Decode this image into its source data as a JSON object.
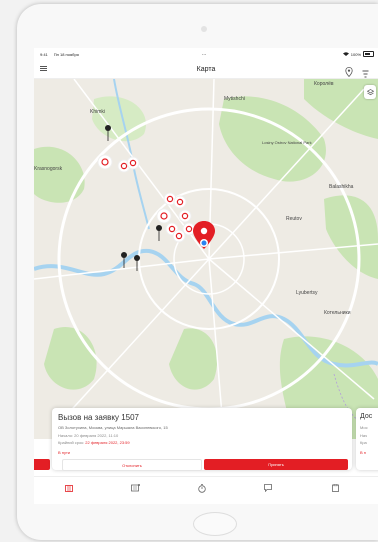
{
  "status_bar": {
    "time": "9:41",
    "date": "Пн 18 ноября",
    "center": "...",
    "signal": "100%"
  },
  "nav": {
    "title": "Карта"
  },
  "map_labels": {
    "khimki": "Khimki",
    "mytishchi": "Mytishchi",
    "korolyov": "Королёв",
    "krasnogorsk": "Krasnogorsk",
    "balashikha": "Balashikha",
    "reutov": "Reutov",
    "lyubertsy": "Lyubertsy",
    "losiny": "Losiny Ostrov National Park",
    "kotelniki": "Котельники"
  },
  "card": {
    "title": "Вызов на заявку 1507",
    "address": "ОВ Золотухина, Москва, улица Маршала Василевского, 15",
    "line1": "Начало: 20 февраля 2022, 11:10",
    "line2_prefix": "Крайний срок: ",
    "line2_highlight": "22 февраля 2022, 23:59",
    "badge": "В пути",
    "reject_label": "Отклонить",
    "accept_label": "Принять"
  },
  "next_card": {
    "title": "Дос",
    "line1": "Мос",
    "line2": "Нач",
    "line3": "Кра",
    "line4": "В п"
  },
  "colors": {
    "accent": "#e31e24",
    "park": "#c9e4b4",
    "water": "#a6d3f0",
    "road": "#ffffff"
  },
  "tabs": [
    {
      "icon": "map-icon",
      "active": true
    },
    {
      "icon": "list-icon",
      "active": false
    },
    {
      "icon": "timer-icon",
      "active": false
    },
    {
      "icon": "chat-icon",
      "active": false
    },
    {
      "icon": "clipboard-icon",
      "active": false
    }
  ]
}
